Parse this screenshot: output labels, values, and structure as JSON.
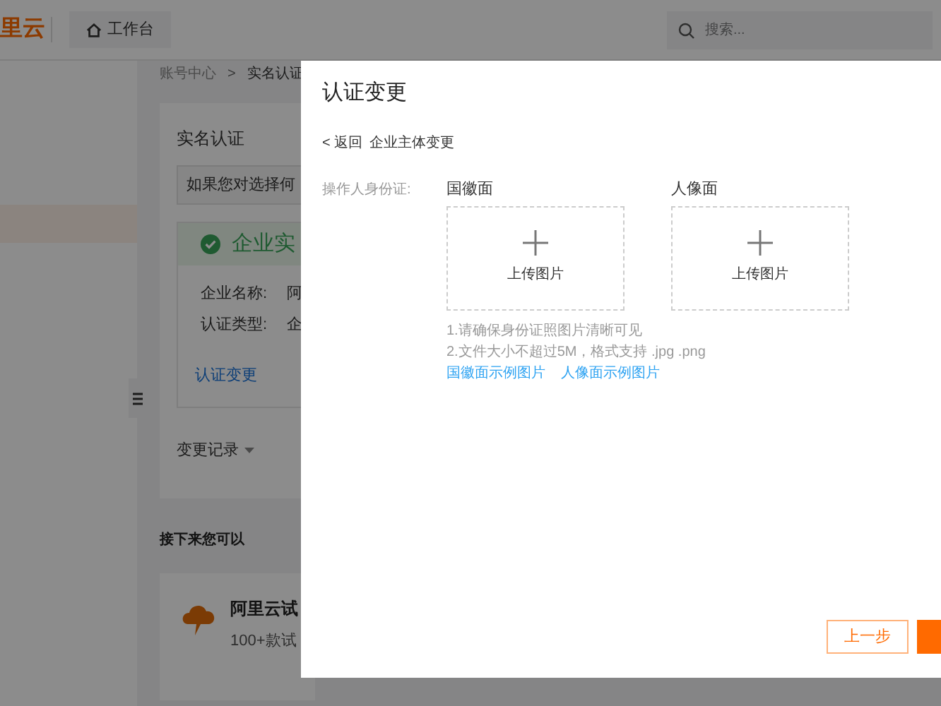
{
  "header": {
    "logo": "里云",
    "workbench": "工作台",
    "search": {
      "placeholder": "搜索..."
    }
  },
  "breadcrumb": {
    "items": [
      "账号中心",
      "实名认证"
    ],
    "separator": ">"
  },
  "card": {
    "title": "实名认证",
    "notice": "如果您对选择何",
    "status": {
      "text": "企业实",
      "verified": true
    },
    "rows": [
      {
        "label": "企业名称:",
        "value": "阿"
      },
      {
        "label": "认证类型:",
        "value": "企"
      }
    ],
    "link": "认证变更",
    "history": "变更记录"
  },
  "next": {
    "title": "接下来您可以",
    "item": {
      "title": "阿里云试",
      "subtitle": "100+款试"
    }
  },
  "modal": {
    "title": "认证变更",
    "back": "< 返回",
    "subtitle": "企业主体变更",
    "field_label": "操作人身份证:",
    "uploads": [
      {
        "heading": "国徽面",
        "button": "上传图片"
      },
      {
        "heading": "人像面",
        "button": "上传图片"
      }
    ],
    "hints": [
      "1.请确保身份证照图片清晰可见",
      "2.文件大小不超过5M，格式支持 .jpg .png"
    ],
    "links": [
      "国徽面示例图片",
      "人像面示例图片"
    ],
    "buttons": [
      {
        "label": "上一步",
        "kind": "outline"
      },
      {
        "kind": "primary"
      }
    ]
  }
}
